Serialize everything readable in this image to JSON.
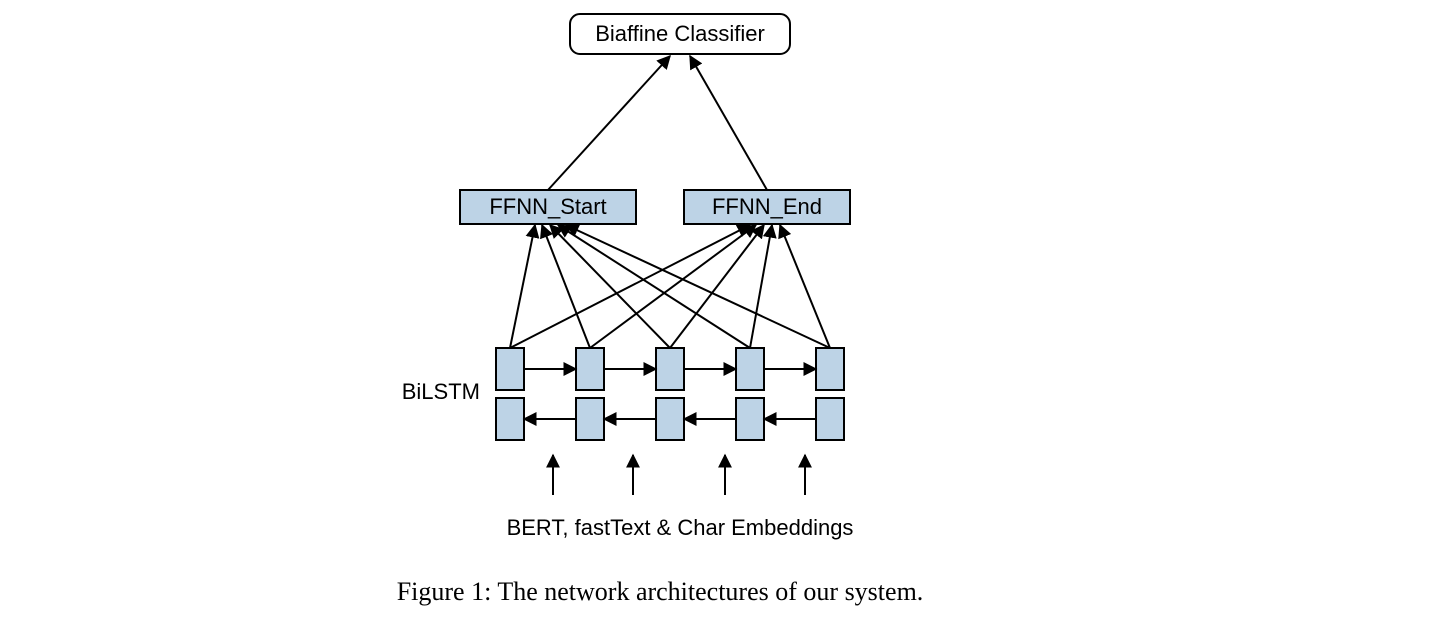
{
  "top": {
    "label": "Biaffine Classifier"
  },
  "ffnn": {
    "start": "FFNN_Start",
    "end": "FFNN_End"
  },
  "side": {
    "bilstm": "BiLSTM"
  },
  "bottom_label": "BERT, fastText & Char Embeddings",
  "caption": "Figure 1: The network architectures of our system."
}
